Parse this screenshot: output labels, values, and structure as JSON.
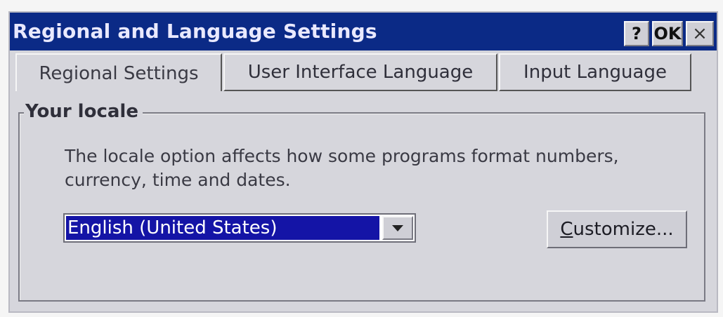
{
  "window": {
    "title": "Regional and Language Settings",
    "buttons": {
      "help": "?",
      "ok": "OK",
      "close": "×"
    }
  },
  "tabs": [
    {
      "label": "Regional Settings",
      "selected": true
    },
    {
      "label": "User Interface Language",
      "selected": false
    },
    {
      "label": "Input Language",
      "selected": false
    }
  ],
  "locale": {
    "group_label": "Your locale",
    "description": "The locale option affects how some programs format numbers, currency, time and dates.",
    "selected_locale": "English (United States)",
    "customize_first": "C",
    "customize_rest": "ustomize..."
  },
  "colors": {
    "titlebar": "#0b2a86",
    "selection": "#1414a6",
    "dialog": "#d6d6dc"
  },
  "icons": {
    "dropdown": "chevron-down-icon"
  }
}
